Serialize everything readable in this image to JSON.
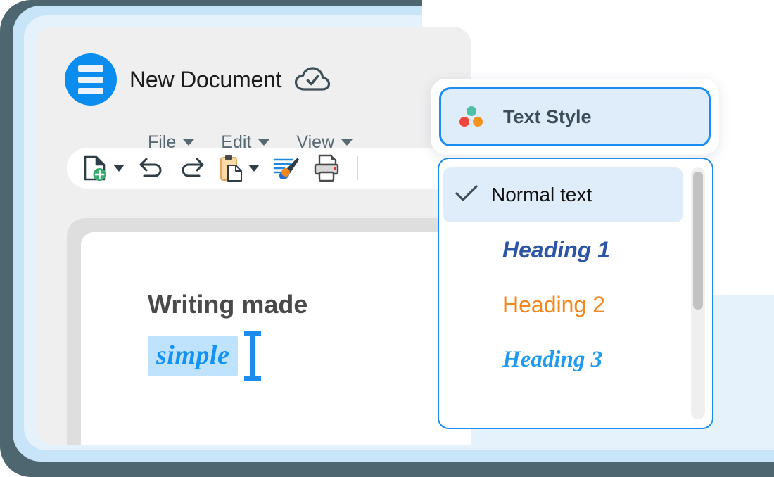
{
  "app": {
    "logo_icon": "hamburger-logo-icon",
    "document_title": "New Document",
    "save_status_icon": "cloud-check-icon"
  },
  "menu_bar": {
    "items": [
      {
        "label": "File",
        "caret": "chevron-down-icon"
      },
      {
        "label": "Edit",
        "caret": "chevron-down-icon"
      },
      {
        "label": "View",
        "caret": "chevron-down-icon"
      }
    ]
  },
  "toolbar": {
    "buttons": [
      {
        "name": "new-document-button",
        "icon": "new-document-icon",
        "has_caret": true
      },
      {
        "name": "undo-button",
        "icon": "undo-icon",
        "has_caret": false
      },
      {
        "name": "redo-button",
        "icon": "redo-icon",
        "has_caret": false
      },
      {
        "name": "paste-button",
        "icon": "clipboard-paste-icon",
        "has_caret": true
      },
      {
        "name": "format-paint-button",
        "icon": "format-paint-brush-icon",
        "has_caret": false
      },
      {
        "name": "print-button",
        "icon": "printer-icon",
        "has_caret": false
      }
    ]
  },
  "document": {
    "line1": "Writing made",
    "line2": "simple",
    "highlight_color": "#bfe2fd",
    "cursor_icon": "text-ibeam-cursor-icon"
  },
  "text_style_button": {
    "label": "Text Style",
    "icon": "three-dots-palette-icon",
    "dot_colors": [
      "#4fbfa5",
      "#f2453d",
      "#f4921e"
    ],
    "border_color": "#1b8df0",
    "fill_color": "#dfedfa"
  },
  "dropdown": {
    "items": [
      {
        "label": "Normal text",
        "selected": true,
        "check_icon": "check-icon",
        "color": "#121212"
      },
      {
        "label": "Heading 1",
        "selected": false,
        "color": "#2d55a5"
      },
      {
        "label": "Heading 2",
        "selected": false,
        "color": "#f4871e"
      },
      {
        "label": "Heading 3",
        "selected": false,
        "color": "#1e9bf0"
      }
    ],
    "scrollbar": {
      "name": "dropdown-scrollbar"
    }
  },
  "theme": {
    "accent_blue": "#0b8df0",
    "window_bg": "#efefef",
    "canvas_bg": "#dedede",
    "backdrop_blue_outer": "#c7e4f9",
    "backdrop_blue_inner": "#e5f2fc",
    "backdrop_slate": "#4d6670"
  }
}
